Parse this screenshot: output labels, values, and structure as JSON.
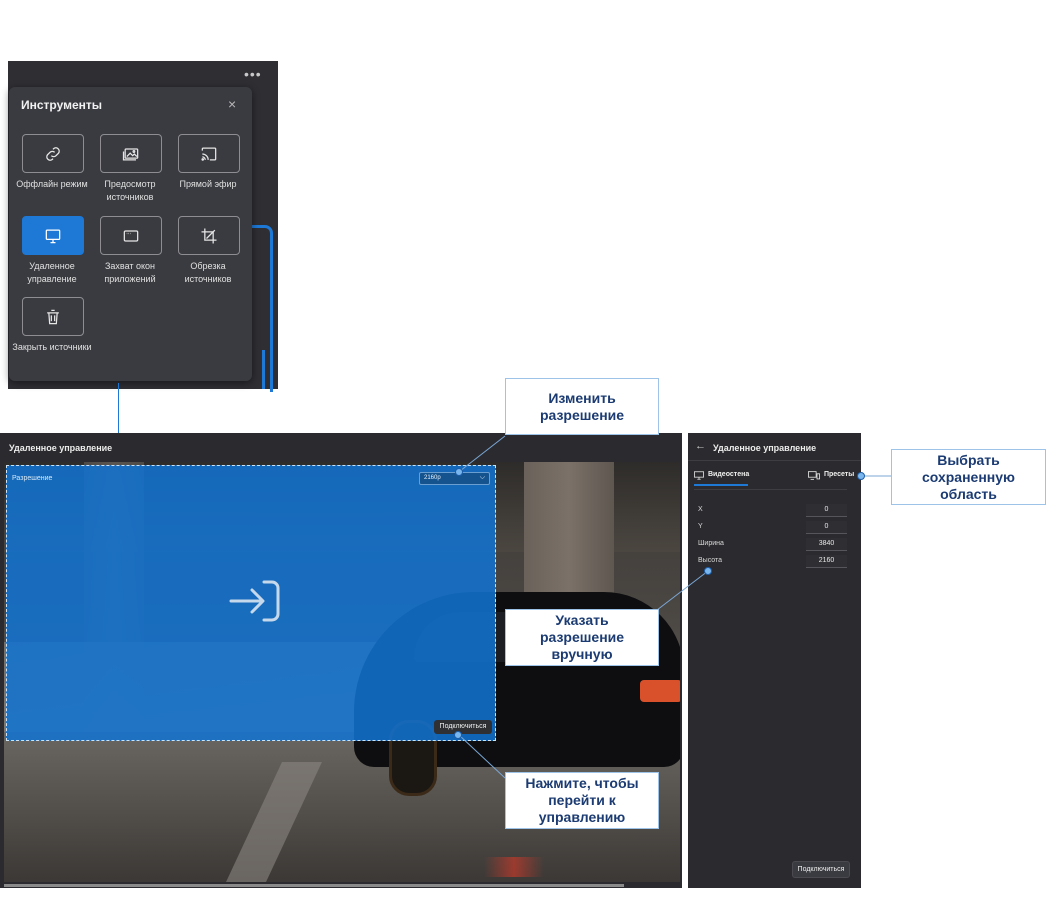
{
  "tools_panel": {
    "dots": "•••",
    "title": "Инструменты",
    "close": "×",
    "items": [
      {
        "label": "Оффлайн режим",
        "icon": "link-icon",
        "active": false
      },
      {
        "label": "Предосмотр источников",
        "icon": "gallery-icon",
        "active": false
      },
      {
        "label": "Прямой эфир",
        "icon": "cast-icon",
        "active": false
      },
      {
        "label": "Удаленное управление",
        "icon": "monitor-icon",
        "active": true
      },
      {
        "label": "Захват окон приложений",
        "icon": "window-icon",
        "active": false
      },
      {
        "label": "Обрезка источников",
        "icon": "crop-icon",
        "active": false
      },
      {
        "label": "Закрыть источники",
        "icon": "trash-icon",
        "active": false
      }
    ]
  },
  "main_window": {
    "title": "Удаленное управление",
    "resolution_label": "Разрешение",
    "resolution_value": "2160p",
    "connect_button": "Подключиться"
  },
  "side_panel": {
    "title": "Удаленное управление",
    "tabs": [
      "Видеостена",
      "Пресеты"
    ],
    "fields": [
      {
        "label": "X",
        "value": "0"
      },
      {
        "label": "Y",
        "value": "0"
      },
      {
        "label": "Ширина",
        "value": "3840"
      },
      {
        "label": "Высота",
        "value": "2160"
      }
    ],
    "connect_button": "Подключиться"
  },
  "callouts": {
    "change_resolution": "Изменить разрешение",
    "choose_saved_area": "Выбрать сохраненную область",
    "manual_resolution": "Указать разрешение вручную",
    "click_to_control": "Нажмите, чтобы перейти к управлению"
  },
  "colors": {
    "accent": "#1d78d6",
    "callout_text": "#1b3b72",
    "callout_border": "#9ec3e8",
    "panel_bg": "#2b2b2f"
  }
}
